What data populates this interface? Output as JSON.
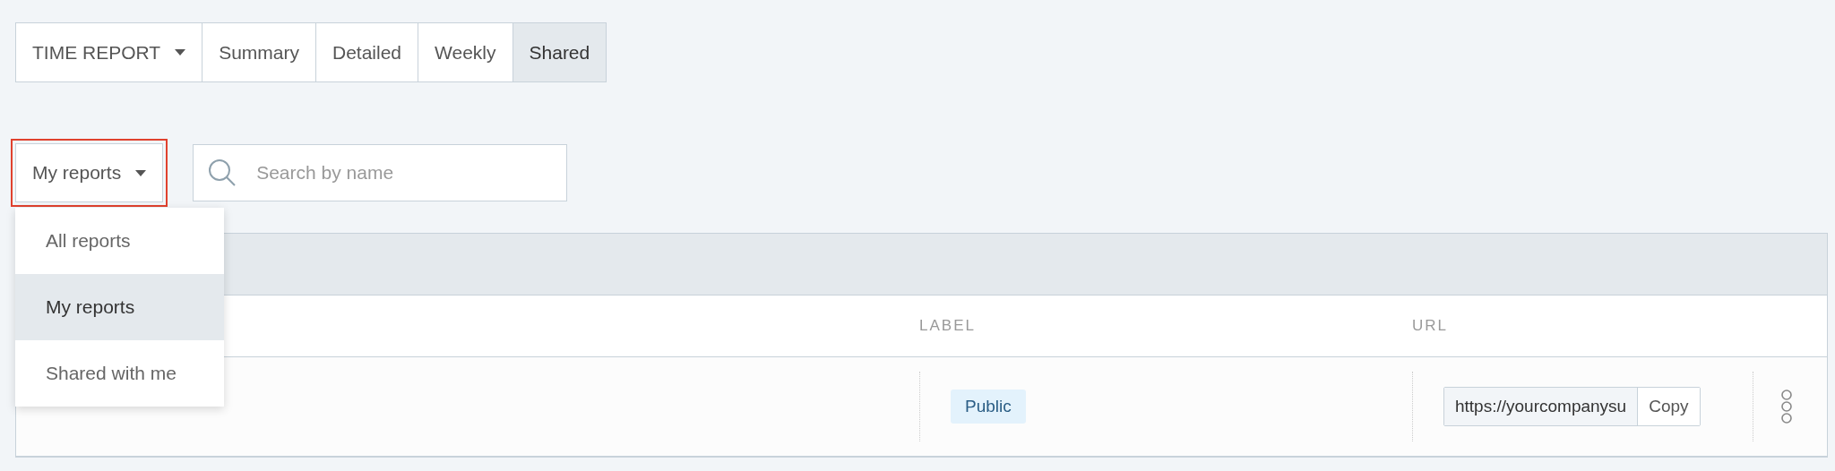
{
  "report_tabs": [
    {
      "label": "TIME REPORT",
      "kind": "dropdown",
      "selected": false
    },
    {
      "label": "Summary",
      "kind": "tab",
      "selected": false
    },
    {
      "label": "Detailed",
      "kind": "tab",
      "selected": false
    },
    {
      "label": "Weekly",
      "kind": "tab",
      "selected": false
    },
    {
      "label": "Shared",
      "kind": "tab",
      "selected": true
    }
  ],
  "filter": {
    "label": "My reports",
    "highlighted": true,
    "expanded": true
  },
  "search": {
    "placeholder": "Search by name"
  },
  "filter_menu": [
    {
      "label": "All reports",
      "selected": false
    },
    {
      "label": "My reports",
      "selected": true
    },
    {
      "label": "Shared with me",
      "selected": false
    }
  ],
  "table": {
    "columns": [
      {
        "label": "LABEL"
      },
      {
        "label": "URL"
      }
    ],
    "rows": [
      {
        "label": "Public",
        "url": "https://yourcompanysu",
        "copy": "Copy"
      }
    ]
  }
}
